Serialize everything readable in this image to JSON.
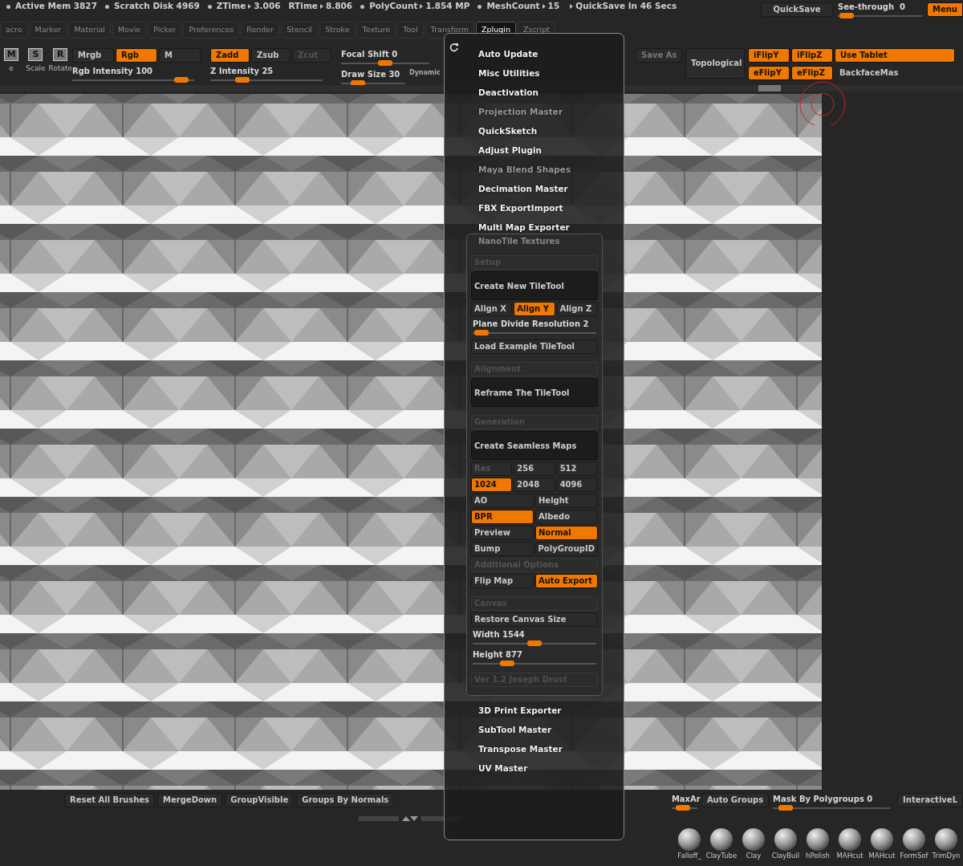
{
  "status_bar": {
    "items": [
      {
        "kind": "plain",
        "dot": true,
        "text": "Active Mem 3827"
      },
      {
        "kind": "plain",
        "dot": true,
        "text": "Scratch Disk 4969"
      },
      {
        "kind": "metric",
        "dot": true,
        "label": "ZTime",
        "value": "3.006"
      },
      {
        "kind": "metric",
        "dot": false,
        "label": "RTime",
        "value": "8.806"
      },
      {
        "kind": "metric",
        "dot": true,
        "label": "PolyCount",
        "value": "1.854 MP"
      },
      {
        "kind": "metric",
        "dot": true,
        "label": "MeshCount",
        "value": "15"
      },
      {
        "kind": "notice",
        "dot": false,
        "text": "QuickSave In 46 Secs"
      }
    ],
    "quicksave": "QuickSave",
    "see_through": {
      "label": "See-through",
      "value": "0",
      "level": 0.03
    },
    "menus_button": "Menu"
  },
  "menu_tabs": [
    {
      "label": "acro",
      "selected": false
    },
    {
      "label": "Marker",
      "selected": false
    },
    {
      "label": "Material",
      "selected": false
    },
    {
      "label": "Movie",
      "selected": false
    },
    {
      "label": "Picker",
      "selected": false
    },
    {
      "label": "Preferences",
      "selected": false
    },
    {
      "label": "Render",
      "selected": false
    },
    {
      "label": "Stencil",
      "selected": false
    },
    {
      "label": "Stroke",
      "selected": false
    },
    {
      "label": "Texture",
      "selected": false
    },
    {
      "label": "Tool",
      "selected": false
    },
    {
      "label": "Transform",
      "selected": false
    },
    {
      "label": "Zplugin",
      "selected": true
    },
    {
      "label": "Zscript",
      "selected": false
    }
  ],
  "toolbar": {
    "transform_tools": [
      {
        "letter": "M",
        "label": "e"
      },
      {
        "letter": "S",
        "label": "Scale"
      },
      {
        "letter": "R",
        "label": "Rotate"
      }
    ],
    "color_modes": [
      {
        "label": "Mrgb",
        "selected": false
      },
      {
        "label": "Rgb",
        "selected": true
      },
      {
        "label": "M",
        "selected": false
      }
    ],
    "rgb_intensity": {
      "label": "Rgb Intensity 100",
      "level": 0.95
    },
    "z_modes": [
      {
        "label": "Zadd",
        "selected": true,
        "disabled": false
      },
      {
        "label": "Zsub",
        "selected": false,
        "disabled": false
      },
      {
        "label": "Zcut",
        "selected": false,
        "disabled": true
      }
    ],
    "z_intensity": {
      "label": "Z Intensity 25",
      "level": 0.25
    },
    "focal_shift": {
      "label": "Focal Shift 0",
      "level": 0.5
    },
    "draw_size": {
      "label": "Draw Size 30",
      "level": 0.2
    },
    "dynamic": "Dynamic",
    "save_as": "Save As",
    "topological": "Topological",
    "flip_buttons": [
      {
        "label": "iFlipY",
        "on": true
      },
      {
        "label": "iFlipZ",
        "on": true
      },
      {
        "label": "Use Tablet",
        "on": true
      },
      {
        "label": "eFlipY",
        "on": true
      },
      {
        "label": "eFlipZ",
        "on": true
      },
      {
        "label": "BackfaceMas",
        "on": false
      }
    ]
  },
  "zplugin_menu": {
    "items_before": [
      {
        "label": "Auto Update",
        "disabled": false
      },
      {
        "label": "Misc Utilities",
        "disabled": false
      },
      {
        "label": "Deactivation",
        "disabled": false
      },
      {
        "label": "Projection Master",
        "disabled": true
      },
      {
        "label": "QuickSketch",
        "disabled": false
      },
      {
        "label": "Adjust Plugin",
        "disabled": false
      },
      {
        "label": "Maya Blend Shapes",
        "disabled": true
      },
      {
        "label": "Decimation Master",
        "disabled": false
      },
      {
        "label": "FBX ExportImport",
        "disabled": false
      },
      {
        "label": "Multi Map Exporter",
        "disabled": false
      }
    ],
    "nanotile": {
      "title": "NanoTile Textures",
      "rows": [
        {
          "kind": "header",
          "label": "Setup"
        },
        {
          "kind": "big",
          "label": "Create New TileTool"
        },
        {
          "kind": "buttons",
          "buttons": [
            {
              "label": "Align X",
              "selected": false
            },
            {
              "label": "Align Y",
              "selected": true
            },
            {
              "label": "Align Z",
              "selected": false
            }
          ]
        },
        {
          "kind": "slider",
          "label": "Plane Divide Resolution 2",
          "level": 0.0
        },
        {
          "kind": "button",
          "label": "Load Example TileTool",
          "disabled": false
        },
        {
          "kind": "header",
          "label": "Alignment"
        },
        {
          "kind": "big",
          "label": "Reframe The TileTool"
        },
        {
          "kind": "header",
          "label": "Generation"
        },
        {
          "kind": "big",
          "label": "Create Seamless Maps"
        },
        {
          "kind": "buttons",
          "buttons": [
            {
              "label": "Res",
              "selected": false,
              "disabled": true
            },
            {
              "label": "256",
              "selected": false,
              "disabled": false
            },
            {
              "label": "512",
              "selected": false,
              "disabled": false
            }
          ]
        },
        {
          "kind": "buttons",
          "buttons": [
            {
              "label": "1024",
              "selected": true
            },
            {
              "label": "2048",
              "selected": false
            },
            {
              "label": "4096",
              "selected": false
            }
          ]
        },
        {
          "kind": "buttons",
          "buttons": [
            {
              "label": "AO",
              "selected": false
            },
            {
              "label": "Height",
              "selected": false
            }
          ]
        },
        {
          "kind": "buttons",
          "buttons": [
            {
              "label": "BPR",
              "selected": true
            },
            {
              "label": "Albedo",
              "selected": false
            }
          ]
        },
        {
          "kind": "buttons",
          "buttons": [
            {
              "label": "Preview",
              "selected": false
            },
            {
              "label": "Normal",
              "selected": true
            }
          ]
        },
        {
          "kind": "buttons",
          "buttons": [
            {
              "label": "Bump",
              "selected": false
            },
            {
              "label": "PolyGroupID",
              "selected": false
            }
          ]
        },
        {
          "kind": "button",
          "label": "Additional Options",
          "disabled": true
        },
        {
          "kind": "buttons",
          "buttons": [
            {
              "label": "Flip Map",
              "selected": false
            },
            {
              "label": "Auto Export",
              "selected": true
            }
          ]
        },
        {
          "kind": "header",
          "label": "Canvas"
        },
        {
          "kind": "button",
          "label": "Restore Canvas Size",
          "disabled": false
        },
        {
          "kind": "slider",
          "label": "Width 1544",
          "level": 0.5
        },
        {
          "kind": "slider",
          "label": "Height 877",
          "level": 0.25
        },
        {
          "kind": "header",
          "label": "Ver 1.2 Joseph Drust"
        }
      ]
    },
    "items_after": [
      {
        "label": "3D Print Exporter",
        "disabled": false
      },
      {
        "label": "SubTool Master",
        "disabled": false
      },
      {
        "label": "Transpose Master",
        "disabled": false
      },
      {
        "label": "UV Master",
        "disabled": false
      }
    ]
  },
  "bottom_bar": [
    {
      "kind": "button",
      "label": "Reset All Brushes"
    },
    {
      "kind": "button",
      "label": "MergeDown"
    },
    {
      "kind": "button",
      "label": "GroupVisible"
    },
    {
      "kind": "button",
      "label": "Groups By Normals"
    },
    {
      "kind": "slider",
      "label": "MaxAr",
      "level": 0.35
    },
    {
      "kind": "button",
      "label": "Auto Groups"
    },
    {
      "kind": "slider",
      "label": "Mask By Polygroups 0",
      "level": 0.05
    },
    {
      "kind": "button",
      "label": "InteractiveL"
    }
  ],
  "brushes": [
    "Falloff_",
    "ClayTube",
    "Clay",
    "ClayBuil",
    "hPolish",
    "MAHcut",
    "MAHcut",
    "FormSof",
    "TrimDyn"
  ]
}
